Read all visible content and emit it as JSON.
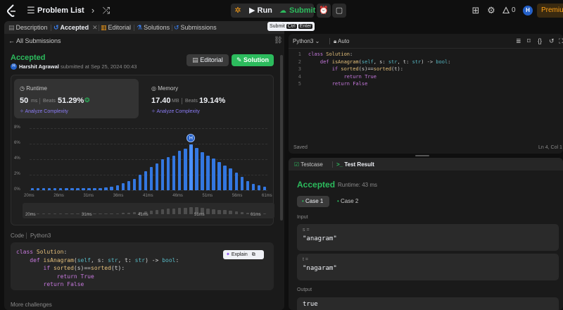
{
  "topbar": {
    "problem_list": "Problem List",
    "run": "Run",
    "submit": "Submit",
    "streak": "0",
    "avatar_initial": "H",
    "premium": "Premium"
  },
  "left_tabs": {
    "description": "Description",
    "accepted": "Accepted",
    "editorial": "Editorial",
    "solutions": "Solutions",
    "submissions": "Submissions"
  },
  "tooltip": {
    "label": "Submit",
    "key1": "Ctrl",
    "key2": "Enter"
  },
  "submission": {
    "all_submissions": "All Submissions",
    "status": "Accepted",
    "user": "Harshit Agrawal",
    "submitted_at": "submitted at Sep 25, 2024 00:43",
    "editorial_btn": "Editorial",
    "solution_btn": "Solution",
    "avatar_initial": "H"
  },
  "runtime": {
    "label": "Runtime",
    "value": "50",
    "unit": "ms",
    "beats_label": "Beats",
    "beats": "51.29%",
    "analyze": "Analyze Complexity"
  },
  "memory": {
    "label": "Memory",
    "value": "17.40",
    "unit": "MB",
    "beats_label": "Beats",
    "beats": "19.14%",
    "analyze": "Analyze Complexity"
  },
  "chart_data": {
    "type": "bar",
    "ylim": [
      0,
      8
    ],
    "yticks": [
      "8%",
      "6%",
      "4%",
      "2%",
      "0%"
    ],
    "xticks": [
      "20ms",
      "26ms",
      "31ms",
      "36ms",
      "41ms",
      "46ms",
      "51ms",
      "56ms",
      "61ms"
    ],
    "values": [
      0.3,
      0.3,
      0.3,
      0.3,
      0.3,
      0.3,
      0.3,
      0.3,
      0.3,
      0.3,
      0.3,
      0.3,
      0.3,
      0.4,
      0.5,
      0.6,
      0.9,
      1.2,
      1.5,
      2.0,
      2.5,
      3.0,
      3.5,
      4.0,
      4.3,
      4.5,
      5.1,
      5.4,
      5.9,
      5.5,
      4.9,
      4.5,
      4.1,
      3.6,
      3.2,
      2.8,
      2.3,
      1.7,
      1.2,
      0.8,
      0.6,
      0.5
    ],
    "highlight_index": 28,
    "marker_label": "H",
    "overview_ticks": [
      "20ms",
      "31ms",
      "41ms",
      "51ms",
      "61ms"
    ]
  },
  "code_section": {
    "code_label": "Code",
    "language": "Python3",
    "explain": "Explain",
    "lines": [
      "class Solution:",
      "    def isAnagram(self, s: str, t: str) -> bool:",
      "        if sorted(s)==sorted(t):",
      "            return True",
      "        return False"
    ]
  },
  "more_challenges": "More challenges",
  "editor": {
    "language": "Python3",
    "mode": "Auto",
    "saved": "Saved",
    "cursor": "Ln 4, Col 1",
    "line_numbers": [
      "1",
      "2",
      "3",
      "4",
      "5"
    ],
    "lines": [
      "class Solution:",
      "    def isAnagram(self, s: str, t: str) -> bool:",
      "        if sorted(s)==sorted(t):",
      "            return True",
      "        return False"
    ]
  },
  "tests": {
    "testcase_tab": "Testcase",
    "result_tab": "Test Result",
    "status": "Accepted",
    "runtime": "Runtime: 43 ms",
    "case1": "Case 1",
    "case2": "Case 2",
    "input_label": "Input",
    "s_label": "s =",
    "s_value": "\"anagram\"",
    "t_label": "t =",
    "t_value": "\"nagaram\"",
    "output_label": "Output",
    "output_value": "true"
  }
}
